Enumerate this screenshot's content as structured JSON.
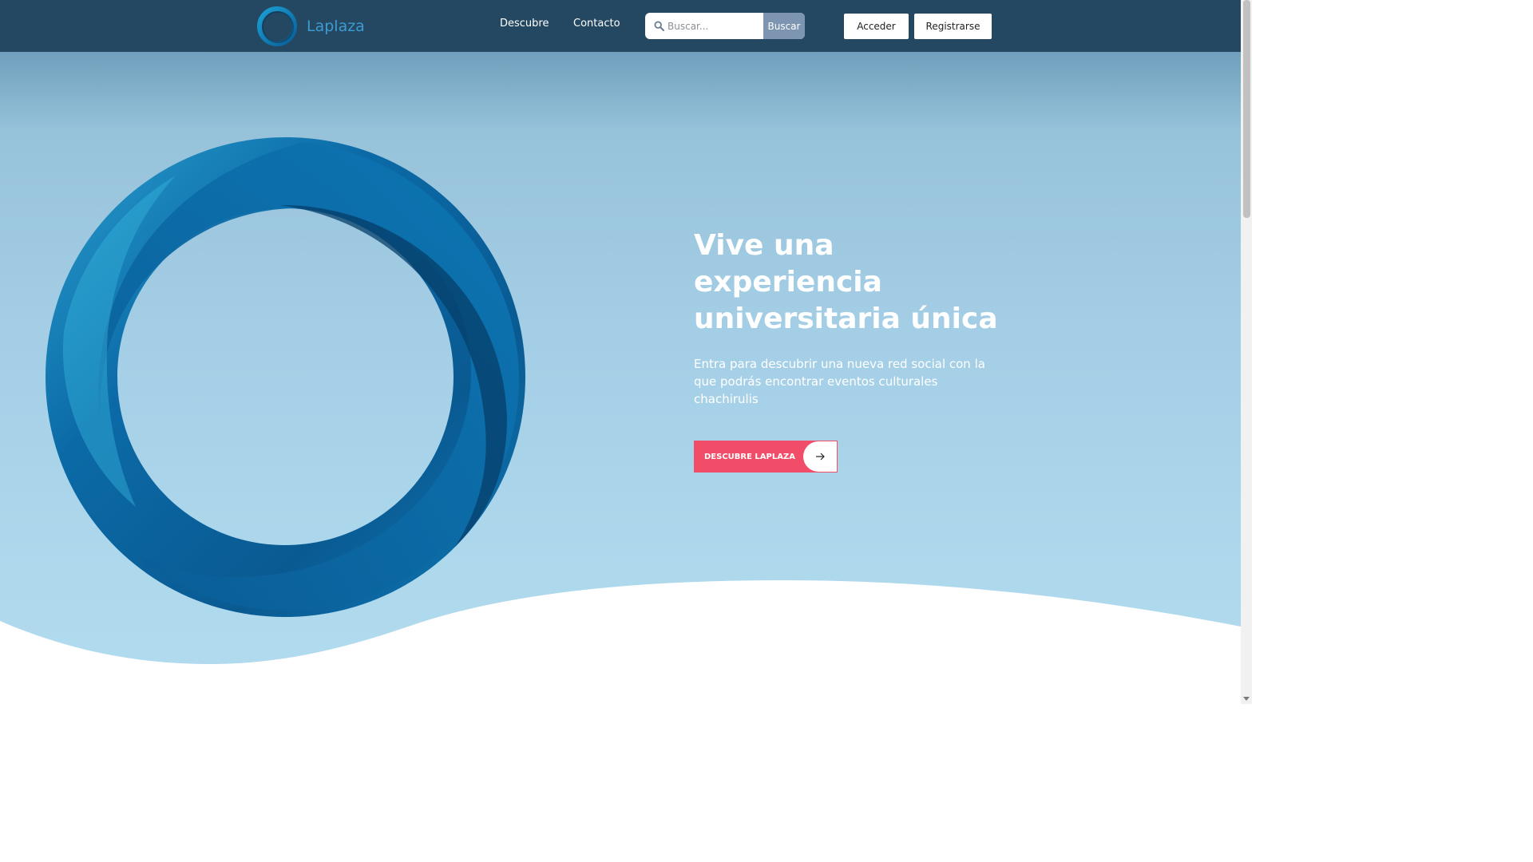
{
  "header": {
    "logo_text": "Laplaza",
    "nav": [
      {
        "label": "Descubre"
      },
      {
        "label": "Contacto"
      }
    ],
    "search": {
      "placeholder": "Buscar...",
      "button_label": "Buscar",
      "icon": "search-icon"
    },
    "login_label": "Acceder",
    "register_label": "Registrarse"
  },
  "hero": {
    "headline": "Vive una experiencia universitaria única",
    "subtext": "Entra para descubrir una nueva red social con la que podrás encontrar eventos culturales chachirulis",
    "cta_label": "DESCUBRE LAPLAZA",
    "cta_icon": "arrow-right-icon"
  },
  "colors": {
    "header_bg": "#244861",
    "brand_blue": "#0073b0",
    "logo_text": "#3d9bd3",
    "search_button": "#7d95b0",
    "cta": "#f14d68",
    "hero_bg": "#a3cde5"
  }
}
